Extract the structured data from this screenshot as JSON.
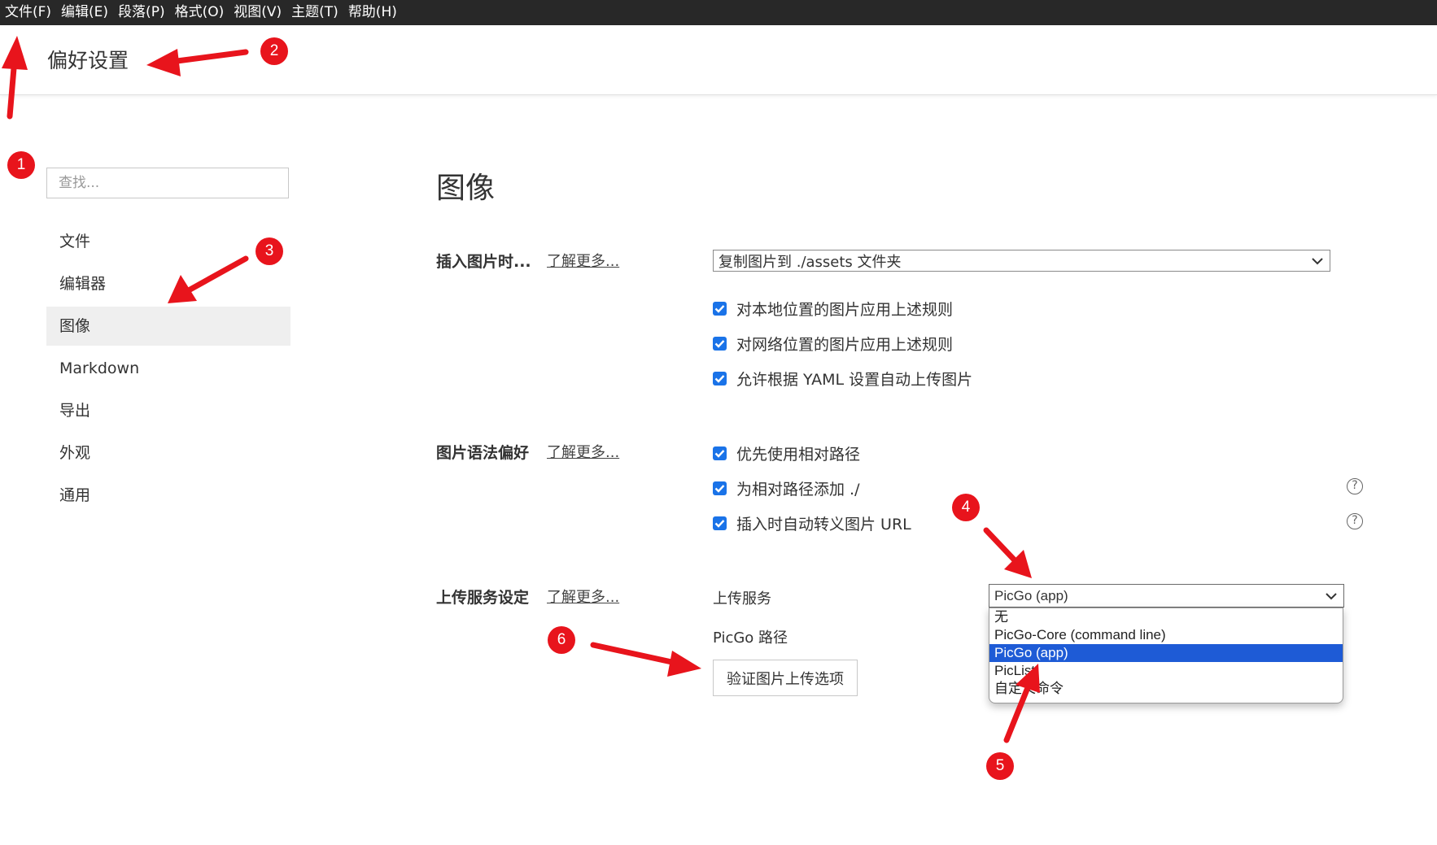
{
  "menubar": {
    "items": [
      "文件(F)",
      "编辑(E)",
      "段落(P)",
      "格式(O)",
      "视图(V)",
      "主题(T)",
      "帮助(H)"
    ]
  },
  "header": {
    "title": "偏好设置"
  },
  "sidebar": {
    "search_placeholder": "查找...",
    "items": [
      {
        "label": "文件",
        "active": false
      },
      {
        "label": "编辑器",
        "active": false
      },
      {
        "label": "图像",
        "active": true
      },
      {
        "label": "Markdown",
        "active": false
      },
      {
        "label": "导出",
        "active": false
      },
      {
        "label": "外观",
        "active": false
      },
      {
        "label": "通用",
        "active": false
      }
    ]
  },
  "main": {
    "section_title": "图像",
    "insert": {
      "label": "插入图片时...",
      "learn_more": "了解更多...",
      "select_value": "复制图片到 ./assets 文件夹",
      "checks": [
        {
          "label": "对本地位置的图片应用上述规则",
          "checked": true
        },
        {
          "label": "对网络位置的图片应用上述规则",
          "checked": true
        },
        {
          "label": "允许根据 YAML 设置自动上传图片",
          "checked": true
        }
      ]
    },
    "syntax": {
      "label": "图片语法偏好",
      "learn_more": "了解更多...",
      "checks": [
        {
          "label": "优先使用相对路径",
          "checked": true
        },
        {
          "label": "为相对路径添加 ./",
          "checked": true
        },
        {
          "label": "插入时自动转义图片 URL",
          "checked": true
        }
      ]
    },
    "upload": {
      "label": "上传服务设定",
      "learn_more": "了解更多...",
      "service_label": "上传服务",
      "service_value": "PicGo (app)",
      "path_label": "PicGo 路径",
      "verify_button": "验证图片上传选项",
      "options": [
        "无",
        "PicGo-Core (command line)",
        "PicGo (app)",
        "PicList",
        "自定义命令"
      ],
      "selected_option": "PicGo (app)"
    }
  },
  "annotations": {
    "color": "#e8141c",
    "markers": [
      "1",
      "2",
      "3",
      "4",
      "5",
      "6"
    ]
  },
  "colors": {
    "menubar_bg": "#282828",
    "checkbox": "#1a73e8",
    "selected_option": "#1e5bd6",
    "active_nav_bg": "#efefef"
  }
}
